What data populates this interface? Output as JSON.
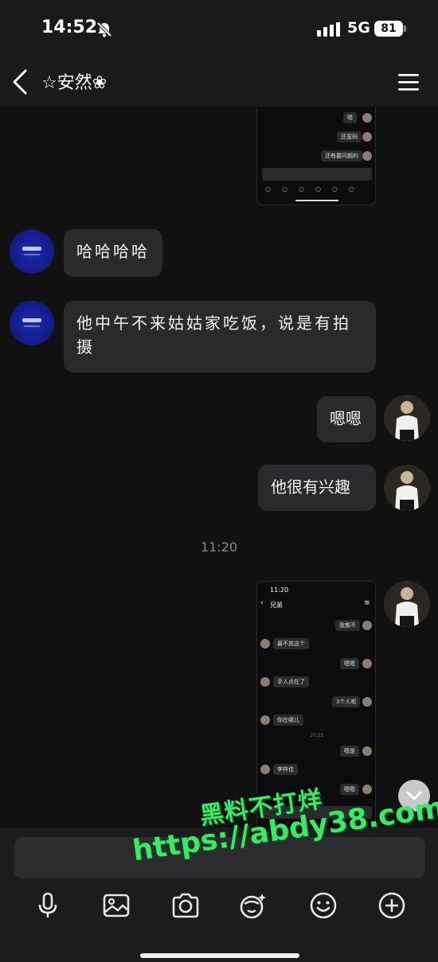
{
  "status_bar": {
    "time": "14:52",
    "network": "5G",
    "battery": "81"
  },
  "nav": {
    "title": "☆安然❀"
  },
  "messages": {
    "laugh": "哈哈哈哈",
    "lunch": "他中午不来姑姑家吃饭，说是有拍摄",
    "agree": "嗯嗯",
    "interest": "他很有兴趣",
    "timestamp": "11:20"
  },
  "thumb1": {
    "rows": [
      "嗯",
      "还蛮码",
      "还有要问题的"
    ]
  },
  "thumb2": {
    "time": "11:20",
    "title": "兄弟",
    "rows": [
      "我都不",
      "最不其这个",
      "嗯嗯",
      "手人点在了",
      "3个人呢",
      "你在哪儿",
      "嗯是",
      "李梓佳",
      "嗯嗯"
    ],
    "stamp": "10:25"
  },
  "watermark": {
    "line1": "黑料不打烊",
    "line2": "https://abdy38.com"
  },
  "input": {
    "placeholder": ""
  },
  "icons": [
    "microphone-icon",
    "image-icon",
    "camera-icon",
    "sticker-icon",
    "emoji-icon",
    "plus-icon"
  ],
  "colors": {
    "background": "#111111",
    "bubble": "#2a2a2c",
    "watermark": "#3fe66a"
  }
}
